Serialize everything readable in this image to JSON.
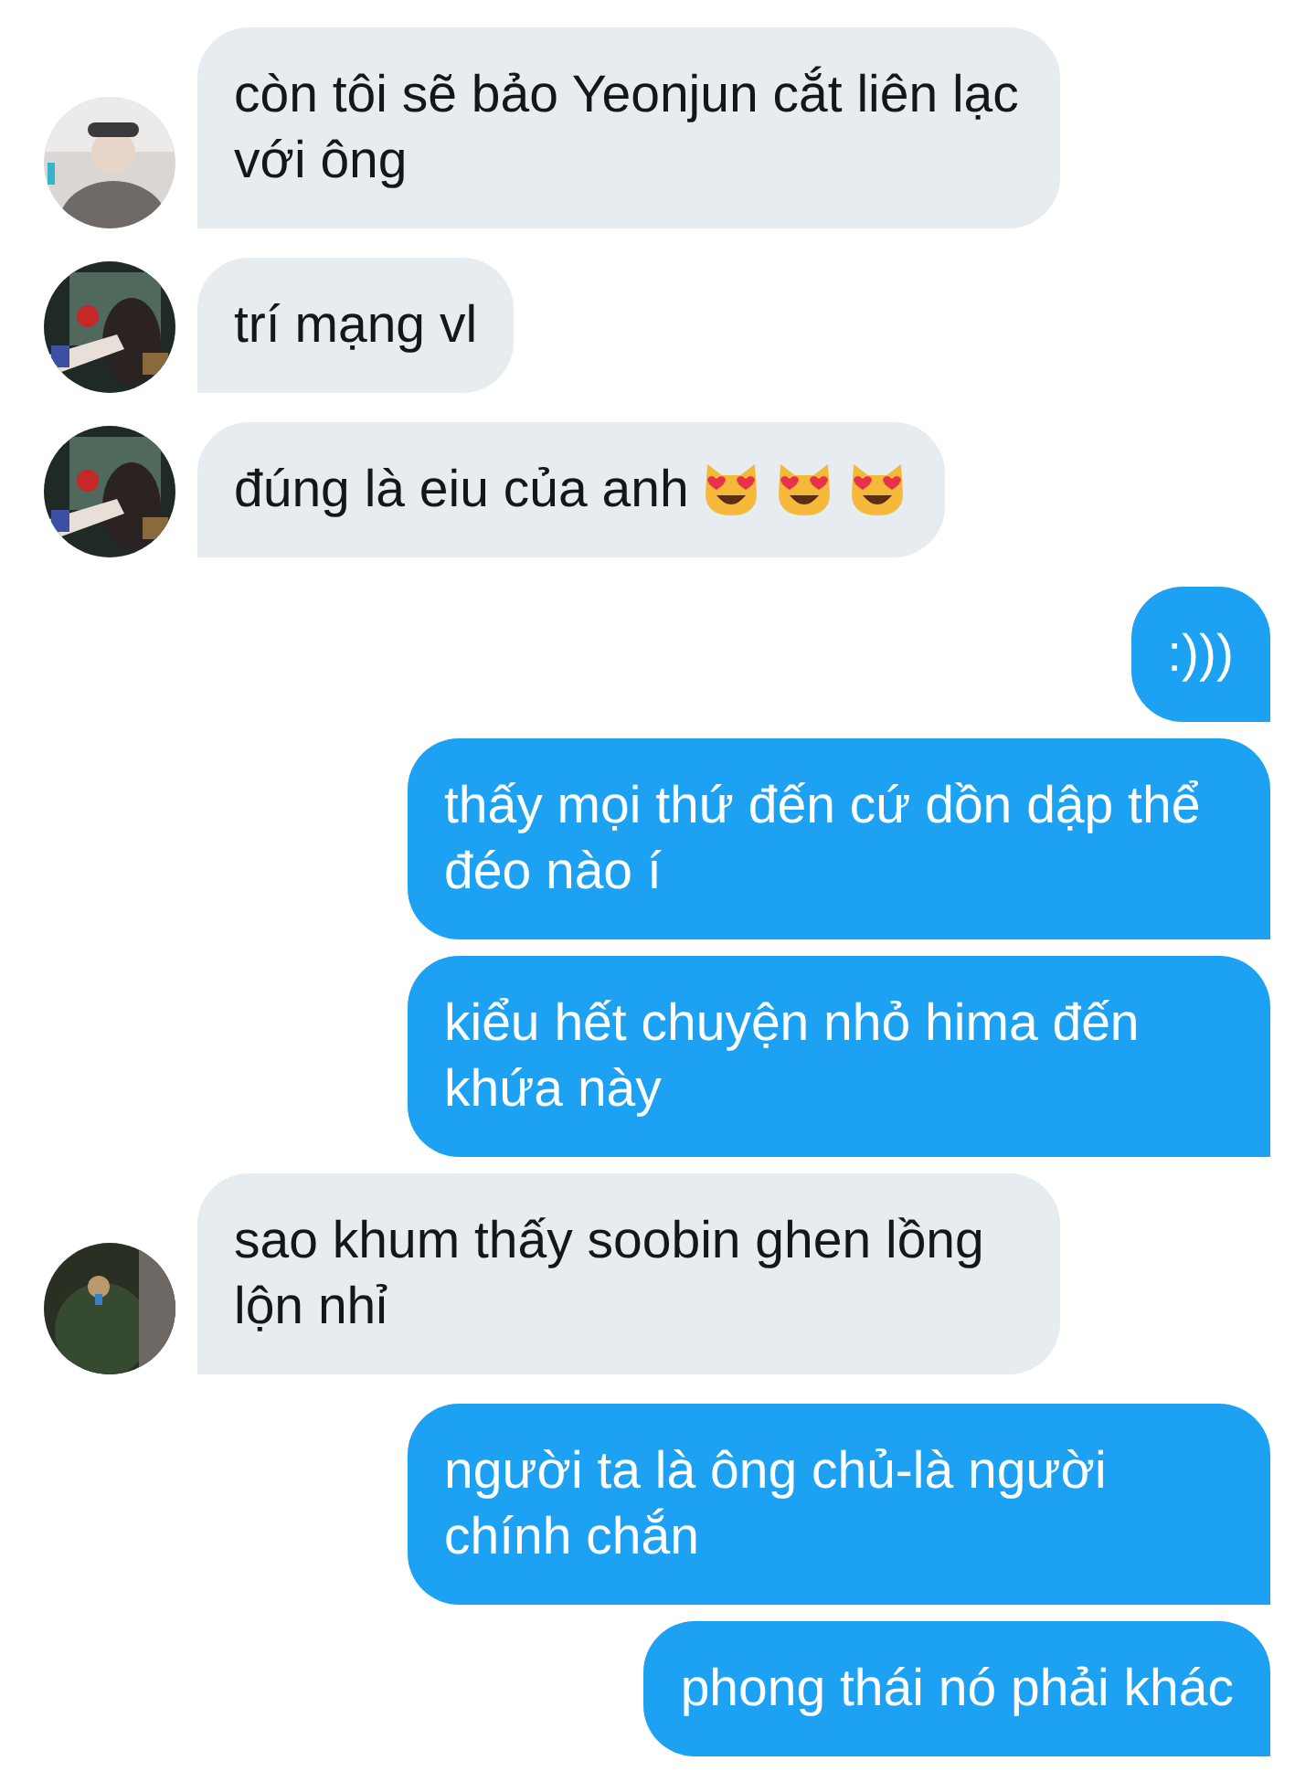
{
  "messages": [
    {
      "kind": "received",
      "text": "còn tôi sẽ bảo Yeonjun cắt liên lạc với ông"
    },
    {
      "kind": "received",
      "text": "trí mạng vl"
    },
    {
      "kind": "received",
      "text": "đúng là eiu của anh",
      "emojis": [
        {
          "kind": "heart-eyes-cat"
        },
        {
          "kind": "heart-eyes-cat"
        },
        {
          "kind": "heart-eyes-cat"
        }
      ]
    },
    {
      "kind": "sent",
      "text": ":)))"
    },
    {
      "kind": "sent",
      "text": "thấy mọi thứ đến cứ dồn dập thể đéo nào í"
    },
    {
      "kind": "sent",
      "text": "kiểu hết chuyện nhỏ hima đến khứa này"
    },
    {
      "kind": "received",
      "text": "sao khum thấy soobin ghen lồng lộn nhỉ"
    },
    {
      "kind": "sent",
      "text": "người ta là ông chủ-là người chính chắn"
    },
    {
      "kind": "sent",
      "text": "phong thái nó phải khác"
    }
  ]
}
